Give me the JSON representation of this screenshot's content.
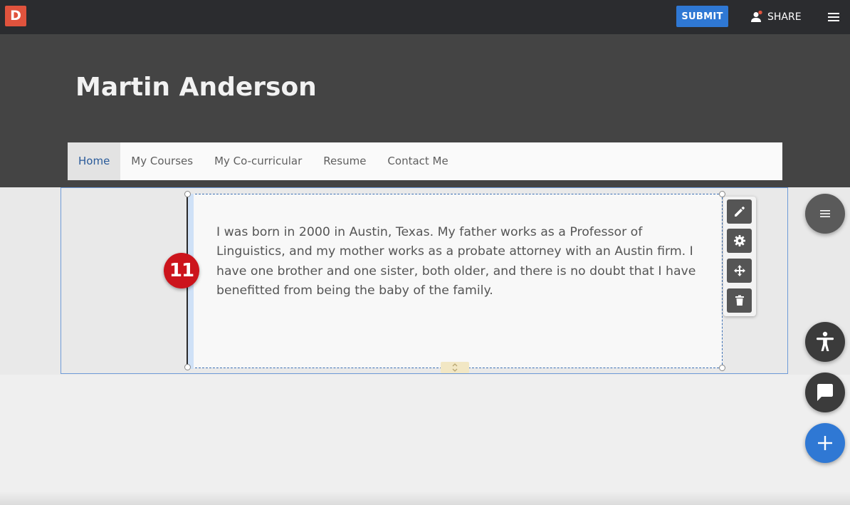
{
  "app": {
    "logo_letter": "D"
  },
  "topbar": {
    "submit_label": "SUBMIT",
    "share_label": "SHARE"
  },
  "header": {
    "title": "Martin Anderson"
  },
  "nav": {
    "items": [
      "Home",
      "My Courses",
      "My Co-curricular",
      "Resume",
      "Contact Me"
    ],
    "active": "Home"
  },
  "content": {
    "bio": "I was born in 2000 in Austin, Texas. My father works as a Professor of Linguistics, and my mother works as a probate attorney with an Austin firm. I have one brother and one sister, both older, and there is no doubt that I have benefitted from being the baby of the family.",
    "step_badge": "11"
  },
  "block_toolbar": {
    "tools": [
      "pencil-icon",
      "gear-icon",
      "move-icon",
      "trash-icon"
    ]
  },
  "floating_buttons": [
    "section-menu",
    "accessibility",
    "chat",
    "add"
  ],
  "colors": {
    "accent": "#2f78d4",
    "logo": "#e0533d",
    "badge": "#cc141c",
    "header_bg": "#444444",
    "topbar_bg": "#2b2c2f"
  }
}
